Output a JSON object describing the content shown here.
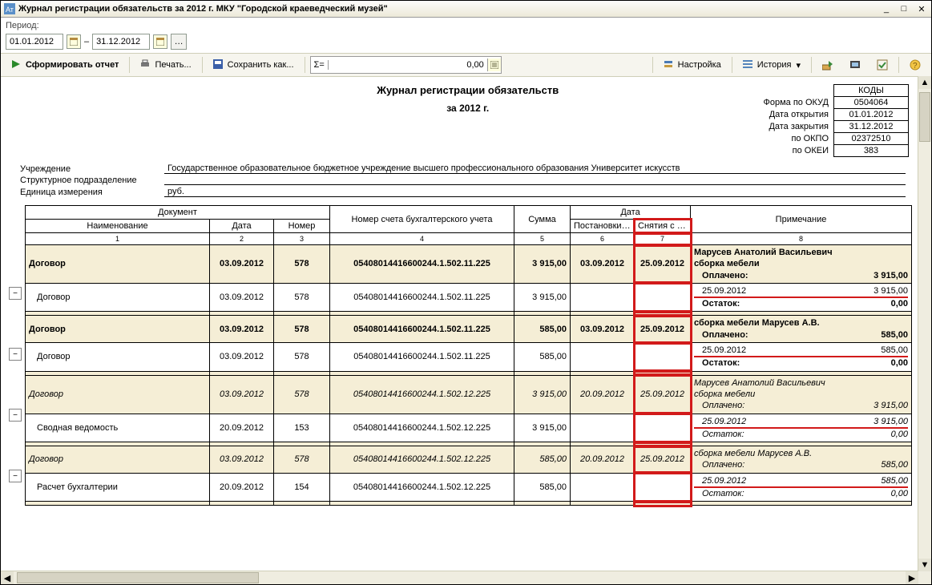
{
  "window": {
    "title": "Журнал регистрации обязательств за 2012 г. МКУ \"Городской краеведческий музей\""
  },
  "period": {
    "label": "Период:",
    "from": "01.01.2012",
    "to": "31.12.2012",
    "sep": "–"
  },
  "toolbar": {
    "form": "Сформировать отчет",
    "print": "Печать...",
    "save": "Сохранить как...",
    "sigma": "Σ=",
    "sigma_val": "0,00",
    "settings": "Настройка",
    "history": "История"
  },
  "report": {
    "title": "Журнал регистрации обязательств",
    "subtitle": "за 2012 г.",
    "codes": {
      "head": "КОДЫ",
      "rows": [
        {
          "label": "Форма по ОКУД",
          "val": "0504064"
        },
        {
          "label": "Дата открытия",
          "val": "01.01.2012"
        },
        {
          "label": "Дата закрытия",
          "val": "31.12.2012"
        },
        {
          "label": "по ОКПО",
          "val": "02372510"
        },
        {
          "label": "по ОКЕИ",
          "val": "383"
        }
      ]
    },
    "info": [
      {
        "label": "Учреждение",
        "val": "Государственное образовательное бюджетное учреждение высшего профессионального образования  Университет искусств"
      },
      {
        "label": "Структурное подразделение",
        "val": ""
      },
      {
        "label": "Единица измерения",
        "val": "руб."
      }
    ],
    "headers": {
      "doc": "Документ",
      "name": "Наименование",
      "date": "Дата",
      "num": "Номер",
      "account": "Номер счета бухгалтерского учета",
      "sum": "Сумма",
      "dategrp": "Дата",
      "post": "Постановки на учет",
      "off": "Снятия с учета",
      "note": "Примечание",
      "cols": [
        "1",
        "2",
        "3",
        "4",
        "5",
        "6",
        "7",
        "8"
      ]
    }
  },
  "rows": [
    {
      "type": "grp",
      "name": "Договор",
      "date": "03.09.2012",
      "num": "578",
      "acc": "05408014416600244.1.502.11.225",
      "sum": "3 915,00",
      "post": "03.09.2012",
      "off": "25.09.2012",
      "note": {
        "l1": "Марусев Анатолий Васильевич",
        "l2": "сборка мебели",
        "paid_l": "Оплачено:",
        "paid_v": "3 915,00"
      }
    },
    {
      "type": "sub",
      "name": "Договор",
      "date": "03.09.2012",
      "num": "578",
      "acc": "05408014416600244.1.502.11.225",
      "sum": "3 915,00",
      "post": "",
      "off": "",
      "note": {
        "d": "25.09.2012",
        "v": "3 915,00",
        "rest_l": "Остаток:",
        "rest_v": "0,00"
      }
    },
    {
      "type": "grp",
      "name": "Договор",
      "date": "03.09.2012",
      "num": "578",
      "acc": "05408014416600244.1.502.11.225",
      "sum": "585,00",
      "post": "03.09.2012",
      "off": "25.09.2012",
      "note": {
        "l1": "",
        "l2": "сборка мебели Марусев А.В.",
        "paid_l": "Оплачено:",
        "paid_v": "585,00"
      }
    },
    {
      "type": "sub",
      "name": "Договор",
      "date": "03.09.2012",
      "num": "578",
      "acc": "05408014416600244.1.502.11.225",
      "sum": "585,00",
      "post": "",
      "off": "",
      "note": {
        "d": "25.09.2012",
        "v": "585,00",
        "rest_l": "Остаток:",
        "rest_v": "0,00"
      }
    },
    {
      "type": "grp",
      "italic": true,
      "name": "Договор",
      "date": "03.09.2012",
      "num": "578",
      "acc": "05408014416600244.1.502.12.225",
      "sum": "3 915,00",
      "post": "20.09.2012",
      "off": "25.09.2012",
      "note": {
        "l1": "Марусев Анатолий Васильевич",
        "l2": "сборка мебели",
        "paid_l": "Оплачено:",
        "paid_v": "3 915,00"
      }
    },
    {
      "type": "sub",
      "name": "Сводная ведомость",
      "date": "20.09.2012",
      "num": "153",
      "acc": "05408014416600244.1.502.12.225",
      "sum": "3 915,00",
      "post": "",
      "off": "",
      "note": {
        "d": "25.09.2012",
        "v": "3 915,00",
        "rest_l": "Остаток:",
        "rest_v": "0,00",
        "italic": true
      }
    },
    {
      "type": "grp",
      "italic": true,
      "name": "Договор",
      "date": "03.09.2012",
      "num": "578",
      "acc": "05408014416600244.1.502.12.225",
      "sum": "585,00",
      "post": "20.09.2012",
      "off": "25.09.2012",
      "note": {
        "l1": "",
        "l2": "сборка мебели Марусев А.В.",
        "paid_l": "Оплачено:",
        "paid_v": "585,00"
      }
    },
    {
      "type": "sub",
      "name": "Расчет бухгалтерии",
      "date": "20.09.2012",
      "num": "154",
      "acc": "05408014416600244.1.502.12.225",
      "sum": "585,00",
      "post": "",
      "off": "",
      "note": {
        "d": "25.09.2012",
        "v": "585,00",
        "rest_l": "Остаток:",
        "rest_v": "0,00",
        "italic": true
      }
    }
  ]
}
